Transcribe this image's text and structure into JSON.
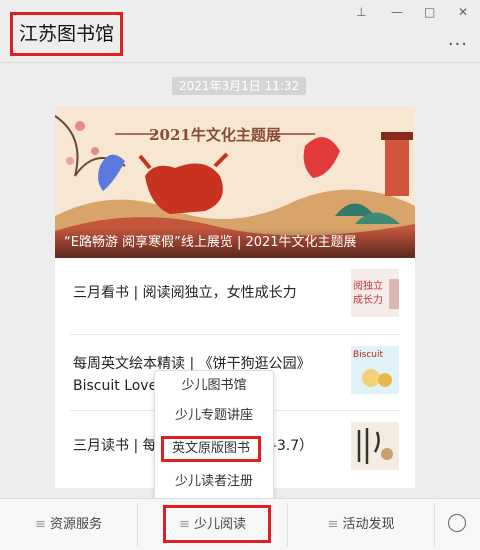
{
  "window": {
    "account_name": "江苏图书馆",
    "controls": {
      "pin": "⊥",
      "minimize": "—",
      "maximize": "□",
      "close": "✕"
    },
    "more": "···"
  },
  "timestamp": "2021年3月1日 11:32",
  "article": {
    "hero_caption": "2021牛文化主题展",
    "hero_title": "“E路畅游  阅享寒假”线上展览 | 2021牛文化主题展",
    "items": [
      {
        "text": "三月看书 | 阅读阅独立，女性成长力",
        "thumb_icon": "book-cover-icon"
      },
      {
        "text_line1": "每周英文绘本精读 | 《饼干狗逛公园》",
        "text_line2": "Biscuit Loves the Park",
        "thumb_icon": "picture-book-icon"
      },
      {
        "text": "三月读书 | 每周新书推荐（3.1—3.7）",
        "thumb_icon": "book-cover-icon"
      }
    ]
  },
  "popup_menu": {
    "items": [
      {
        "label": "少儿图书馆"
      },
      {
        "label": "少儿专题讲座"
      },
      {
        "label": "英文原版图书",
        "highlighted": true
      },
      {
        "label": "少儿读者注册"
      }
    ]
  },
  "menu_bar": {
    "items": [
      {
        "label": "资源服务"
      },
      {
        "label": "少儿阅读",
        "highlighted": true
      },
      {
        "label": "活动发现"
      }
    ],
    "keyboard_icon": "keyboard-icon"
  },
  "colors": {
    "highlight": "#e02020",
    "background": "#ededed"
  }
}
